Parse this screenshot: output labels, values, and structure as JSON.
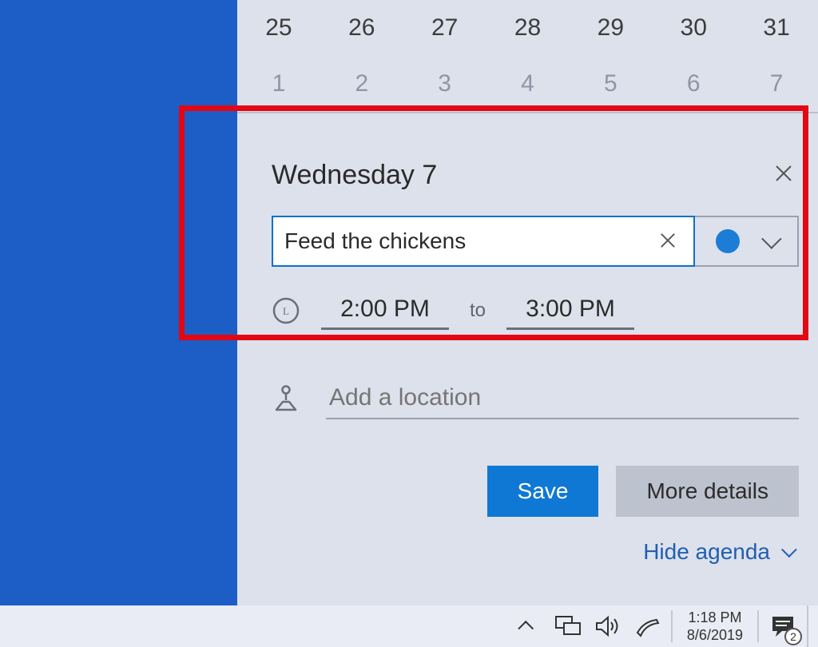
{
  "calendar": {
    "row1": [
      "25",
      "26",
      "27",
      "28",
      "29",
      "30",
      "31"
    ],
    "row2": [
      "1",
      "2",
      "3",
      "4",
      "5",
      "6",
      "7"
    ]
  },
  "event": {
    "day_title": "Wednesday 7",
    "title_value": "Feed the chickens",
    "start_time": "2:00 PM",
    "to_label": "to",
    "end_time": "3:00 PM",
    "location_placeholder": "Add a location",
    "save_label": "Save",
    "more_details_label": "More details",
    "hide_agenda_label": "Hide agenda",
    "category_color": "#1d7dd6"
  },
  "taskbar": {
    "time": "1:18 PM",
    "date": "8/6/2019",
    "notification_count": "2"
  }
}
